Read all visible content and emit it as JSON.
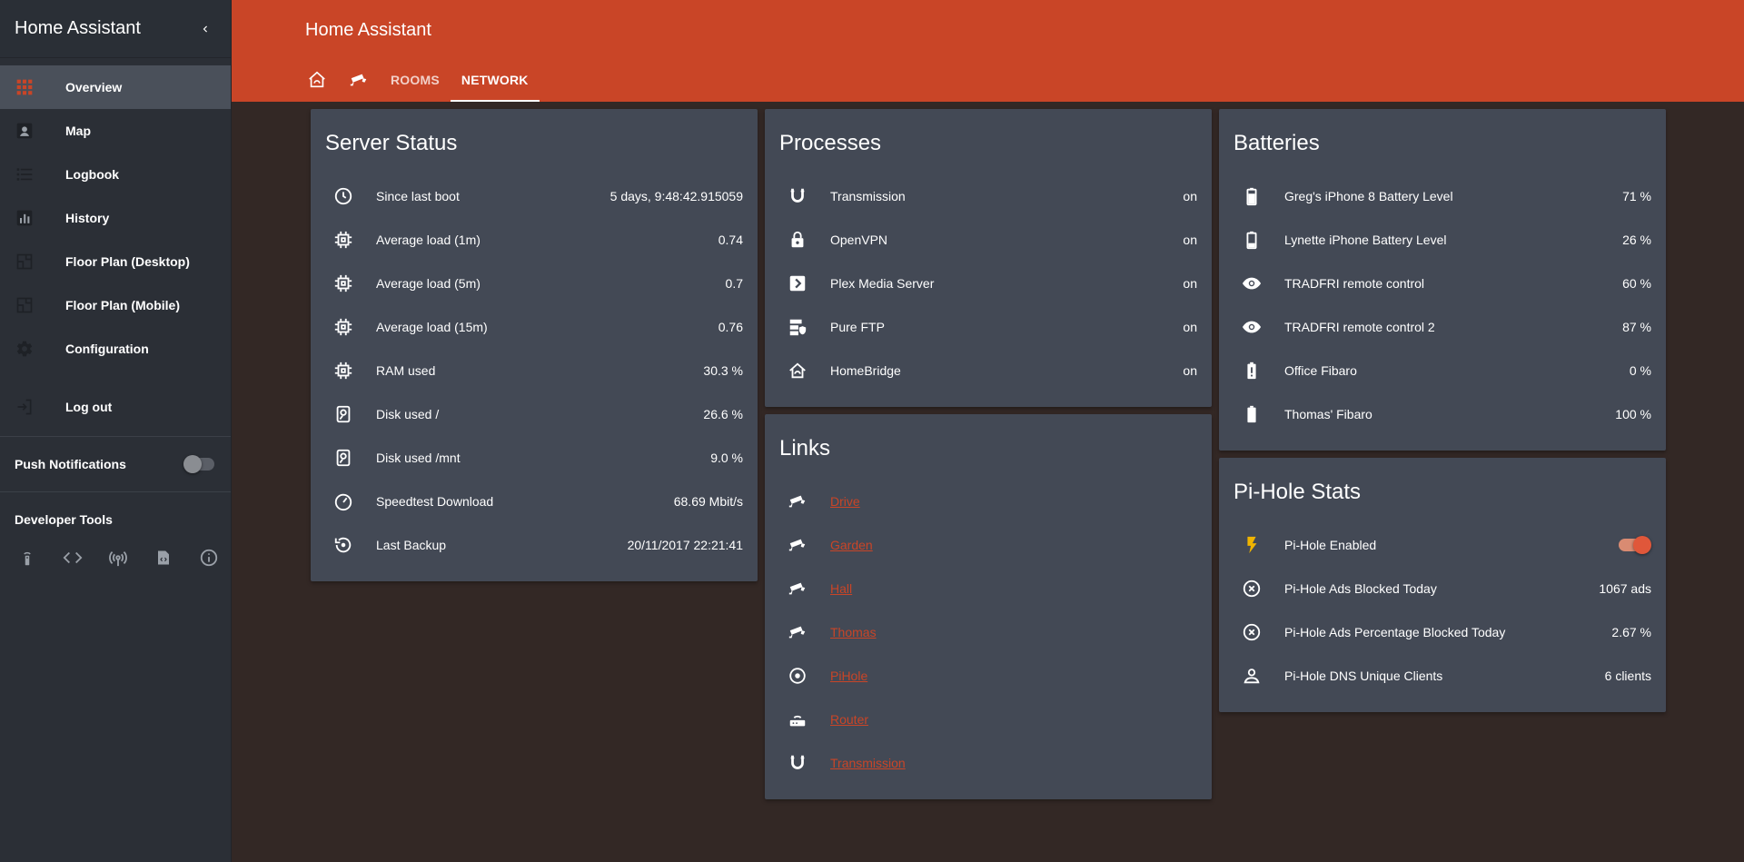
{
  "sidebar": {
    "title": "Home Assistant",
    "items": [
      {
        "label": "Overview",
        "icon": "grid-icon"
      },
      {
        "label": "Map",
        "icon": "map-icon"
      },
      {
        "label": "Logbook",
        "icon": "list-icon"
      },
      {
        "label": "History",
        "icon": "chart-icon"
      },
      {
        "label": "Floor Plan (Desktop)",
        "icon": "floorplan-icon"
      },
      {
        "label": "Floor Plan (Mobile)",
        "icon": "floorplan-icon"
      },
      {
        "label": "Configuration",
        "icon": "gear-icon"
      }
    ],
    "logout": "Log out",
    "push_notifications": "Push Notifications",
    "push_enabled": false,
    "developer_tools": "Developer Tools",
    "dev_tool_icons": [
      "remote-icon",
      "code-icon",
      "broadcast-icon",
      "template-icon",
      "info-icon"
    ]
  },
  "header": {
    "title": "Home Assistant",
    "tabs": [
      {
        "label": "",
        "icon": "home-icon"
      },
      {
        "label": "",
        "icon": "cctv-icon"
      },
      {
        "label": "ROOMS"
      },
      {
        "label": "NETWORK",
        "active": true
      }
    ]
  },
  "cards": {
    "server_status": {
      "title": "Server Status",
      "rows": [
        {
          "name": "Since last boot",
          "value": "5 days, 9:48:42.915059",
          "icon": "clock-icon"
        },
        {
          "name": "Average load (1m)",
          "value": "0.74",
          "icon": "chip-icon"
        },
        {
          "name": "Average load (5m)",
          "value": "0.7",
          "icon": "chip-icon"
        },
        {
          "name": "Average load (15m)",
          "value": "0.76",
          "icon": "chip-icon"
        },
        {
          "name": "RAM used",
          "value": "30.3 %",
          "icon": "chip-icon"
        },
        {
          "name": "Disk used /",
          "value": "26.6 %",
          "icon": "harddisk-icon"
        },
        {
          "name": "Disk used /mnt",
          "value": "9.0 %",
          "icon": "harddisk-icon"
        },
        {
          "name": "Speedtest Download",
          "value": "68.69 Mbit/s",
          "icon": "speedometer-icon"
        },
        {
          "name": "Last Backup",
          "value": "20/11/2017 22:21:41",
          "icon": "backup-restore-icon"
        }
      ]
    },
    "processes": {
      "title": "Processes",
      "rows": [
        {
          "name": "Transmission",
          "value": "on",
          "icon": "magnet-icon"
        },
        {
          "name": "OpenVPN",
          "value": "on",
          "icon": "lock-icon"
        },
        {
          "name": "Plex Media Server",
          "value": "on",
          "icon": "plex-icon"
        },
        {
          "name": "Pure FTP",
          "value": "on",
          "icon": "server-security-icon"
        },
        {
          "name": "HomeBridge",
          "value": "on",
          "icon": "home-icon"
        }
      ]
    },
    "links": {
      "title": "Links",
      "rows": [
        {
          "name": "Drive",
          "icon": "cctv-icon"
        },
        {
          "name": "Garden",
          "icon": "cctv-icon"
        },
        {
          "name": "Hall",
          "icon": "cctv-icon"
        },
        {
          "name": "Thomas",
          "icon": "cctv-icon"
        },
        {
          "name": "PiHole",
          "icon": "target-icon"
        },
        {
          "name": "Router",
          "icon": "router-icon"
        },
        {
          "name": "Transmission",
          "icon": "magnet-icon"
        }
      ]
    },
    "batteries": {
      "title": "Batteries",
      "rows": [
        {
          "name": "Greg's iPhone 8 Battery Level",
          "value": "71 %",
          "icon": "battery-70-icon"
        },
        {
          "name": "Lynette iPhone Battery Level",
          "value": "26 %",
          "icon": "battery-20-icon"
        },
        {
          "name": "TRADFRI remote control",
          "value": "60 %",
          "icon": "eye-icon"
        },
        {
          "name": "TRADFRI remote control 2",
          "value": "87 %",
          "icon": "eye-icon"
        },
        {
          "name": "Office Fibaro",
          "value": "0 %",
          "icon": "battery-alert-icon"
        },
        {
          "name": "Thomas' Fibaro",
          "value": "100 %",
          "icon": "battery-full-icon"
        }
      ]
    },
    "pihole": {
      "title": "Pi-Hole Stats",
      "rows": [
        {
          "name": "Pi-Hole Enabled",
          "value": "",
          "icon": "flash-icon",
          "toggle": true
        },
        {
          "name": "Pi-Hole Ads Blocked Today",
          "value": "1067 ads",
          "icon": "close-circle-icon"
        },
        {
          "name": "Pi-Hole Ads Percentage Blocked Today",
          "value": "2.67 %",
          "icon": "close-circle-icon"
        },
        {
          "name": "Pi-Hole DNS Unique Clients",
          "value": "6 clients",
          "icon": "account-icon"
        }
      ]
    }
  },
  "colors": {
    "accent": "#c94527",
    "sidebar_bg": "#2b2f36",
    "card_bg": "#434955",
    "page_bg": "#332825",
    "flash": "#f0b400"
  }
}
